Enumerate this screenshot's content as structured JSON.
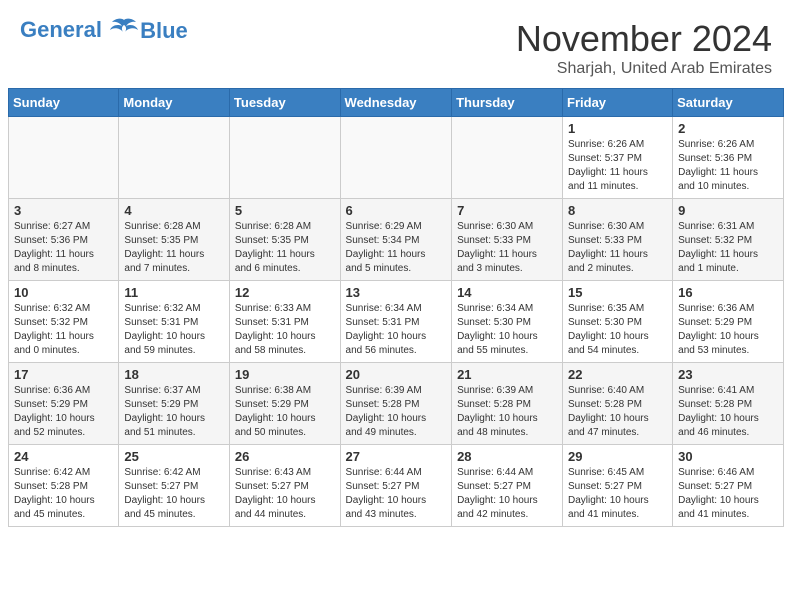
{
  "header": {
    "logo_line1": "General",
    "logo_line2": "Blue",
    "month_year": "November 2024",
    "location": "Sharjah, United Arab Emirates"
  },
  "weekdays": [
    "Sunday",
    "Monday",
    "Tuesday",
    "Wednesday",
    "Thursday",
    "Friday",
    "Saturday"
  ],
  "weeks": [
    [
      {
        "day": "",
        "info": ""
      },
      {
        "day": "",
        "info": ""
      },
      {
        "day": "",
        "info": ""
      },
      {
        "day": "",
        "info": ""
      },
      {
        "day": "",
        "info": ""
      },
      {
        "day": "1",
        "info": "Sunrise: 6:26 AM\nSunset: 5:37 PM\nDaylight: 11 hours\nand 11 minutes."
      },
      {
        "day": "2",
        "info": "Sunrise: 6:26 AM\nSunset: 5:36 PM\nDaylight: 11 hours\nand 10 minutes."
      }
    ],
    [
      {
        "day": "3",
        "info": "Sunrise: 6:27 AM\nSunset: 5:36 PM\nDaylight: 11 hours\nand 8 minutes."
      },
      {
        "day": "4",
        "info": "Sunrise: 6:28 AM\nSunset: 5:35 PM\nDaylight: 11 hours\nand 7 minutes."
      },
      {
        "day": "5",
        "info": "Sunrise: 6:28 AM\nSunset: 5:35 PM\nDaylight: 11 hours\nand 6 minutes."
      },
      {
        "day": "6",
        "info": "Sunrise: 6:29 AM\nSunset: 5:34 PM\nDaylight: 11 hours\nand 5 minutes."
      },
      {
        "day": "7",
        "info": "Sunrise: 6:30 AM\nSunset: 5:33 PM\nDaylight: 11 hours\nand 3 minutes."
      },
      {
        "day": "8",
        "info": "Sunrise: 6:30 AM\nSunset: 5:33 PM\nDaylight: 11 hours\nand 2 minutes."
      },
      {
        "day": "9",
        "info": "Sunrise: 6:31 AM\nSunset: 5:32 PM\nDaylight: 11 hours\nand 1 minute."
      }
    ],
    [
      {
        "day": "10",
        "info": "Sunrise: 6:32 AM\nSunset: 5:32 PM\nDaylight: 11 hours\nand 0 minutes."
      },
      {
        "day": "11",
        "info": "Sunrise: 6:32 AM\nSunset: 5:31 PM\nDaylight: 10 hours\nand 59 minutes."
      },
      {
        "day": "12",
        "info": "Sunrise: 6:33 AM\nSunset: 5:31 PM\nDaylight: 10 hours\nand 58 minutes."
      },
      {
        "day": "13",
        "info": "Sunrise: 6:34 AM\nSunset: 5:31 PM\nDaylight: 10 hours\nand 56 minutes."
      },
      {
        "day": "14",
        "info": "Sunrise: 6:34 AM\nSunset: 5:30 PM\nDaylight: 10 hours\nand 55 minutes."
      },
      {
        "day": "15",
        "info": "Sunrise: 6:35 AM\nSunset: 5:30 PM\nDaylight: 10 hours\nand 54 minutes."
      },
      {
        "day": "16",
        "info": "Sunrise: 6:36 AM\nSunset: 5:29 PM\nDaylight: 10 hours\nand 53 minutes."
      }
    ],
    [
      {
        "day": "17",
        "info": "Sunrise: 6:36 AM\nSunset: 5:29 PM\nDaylight: 10 hours\nand 52 minutes."
      },
      {
        "day": "18",
        "info": "Sunrise: 6:37 AM\nSunset: 5:29 PM\nDaylight: 10 hours\nand 51 minutes."
      },
      {
        "day": "19",
        "info": "Sunrise: 6:38 AM\nSunset: 5:29 PM\nDaylight: 10 hours\nand 50 minutes."
      },
      {
        "day": "20",
        "info": "Sunrise: 6:39 AM\nSunset: 5:28 PM\nDaylight: 10 hours\nand 49 minutes."
      },
      {
        "day": "21",
        "info": "Sunrise: 6:39 AM\nSunset: 5:28 PM\nDaylight: 10 hours\nand 48 minutes."
      },
      {
        "day": "22",
        "info": "Sunrise: 6:40 AM\nSunset: 5:28 PM\nDaylight: 10 hours\nand 47 minutes."
      },
      {
        "day": "23",
        "info": "Sunrise: 6:41 AM\nSunset: 5:28 PM\nDaylight: 10 hours\nand 46 minutes."
      }
    ],
    [
      {
        "day": "24",
        "info": "Sunrise: 6:42 AM\nSunset: 5:28 PM\nDaylight: 10 hours\nand 45 minutes."
      },
      {
        "day": "25",
        "info": "Sunrise: 6:42 AM\nSunset: 5:27 PM\nDaylight: 10 hours\nand 45 minutes."
      },
      {
        "day": "26",
        "info": "Sunrise: 6:43 AM\nSunset: 5:27 PM\nDaylight: 10 hours\nand 44 minutes."
      },
      {
        "day": "27",
        "info": "Sunrise: 6:44 AM\nSunset: 5:27 PM\nDaylight: 10 hours\nand 43 minutes."
      },
      {
        "day": "28",
        "info": "Sunrise: 6:44 AM\nSunset: 5:27 PM\nDaylight: 10 hours\nand 42 minutes."
      },
      {
        "day": "29",
        "info": "Sunrise: 6:45 AM\nSunset: 5:27 PM\nDaylight: 10 hours\nand 41 minutes."
      },
      {
        "day": "30",
        "info": "Sunrise: 6:46 AM\nSunset: 5:27 PM\nDaylight: 10 hours\nand 41 minutes."
      }
    ]
  ]
}
